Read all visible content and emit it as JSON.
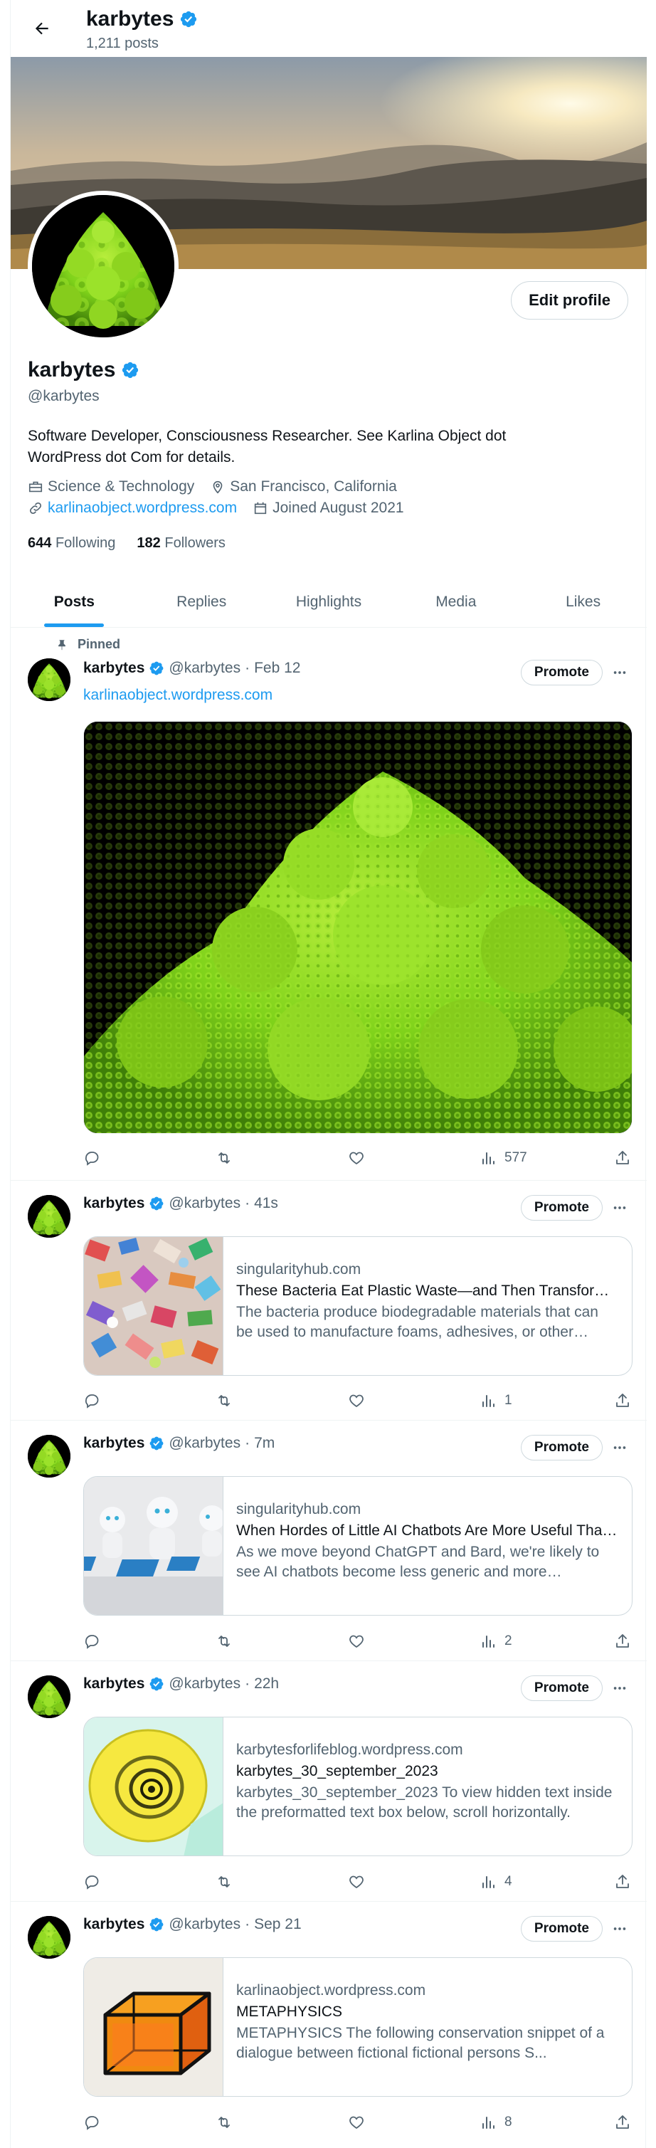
{
  "header": {
    "name": "karbytes",
    "post_count": "1,211 posts"
  },
  "profile": {
    "name": "karbytes",
    "handle": "@karbytes",
    "edit_label": "Edit profile",
    "bio": "Software Developer, Consciousness Researcher. See Karlina Object dot WordPress dot Com for details.",
    "category": "Science & Technology",
    "location": "San Francisco, California",
    "website": "karlinaobject.wordpress.com",
    "joined": "Joined August 2021",
    "following_count": "644",
    "following_label": "Following",
    "followers_count": "182",
    "followers_label": "Followers"
  },
  "tabs": [
    {
      "label": "Posts"
    },
    {
      "label": "Replies"
    },
    {
      "label": "Highlights"
    },
    {
      "label": "Media"
    },
    {
      "label": "Likes"
    }
  ],
  "posts": [
    {
      "pinned_label": "Pinned",
      "name": "karbytes",
      "handle": "@karbytes",
      "time": "Feb 12",
      "link": "karlinaobject.wordpress.com",
      "promote": "Promote",
      "views": "577"
    },
    {
      "name": "karbytes",
      "handle": "@karbytes",
      "time": "41s",
      "promote": "Promote",
      "card_domain": "singularityhub.com",
      "card_title": "These Bacteria Eat Plastic Waste—and Then Transform It Into Useful Products",
      "card_desc": "The bacteria produce biodegradable materials that can be used to manufacture foams, adhesives, or other products.",
      "views": "1"
    },
    {
      "name": "karbytes",
      "handle": "@karbytes",
      "time": "7m",
      "promote": "Promote",
      "card_domain": "singularityhub.com",
      "card_title": "When Hordes of Little AI Chatbots Are More Useful Than Giants",
      "card_desc": "As we move beyond ChatGPT and Bard, we're likely to see AI chatbots become less generic and more specialized.",
      "views": "2"
    },
    {
      "name": "karbytes",
      "handle": "@karbytes",
      "time": "22h",
      "promote": "Promote",
      "card_domain": "karbytesforlifeblog.wordpress.com",
      "card_title": "karbytes_30_september_2023",
      "card_desc": "karbytes_30_september_2023 To view hidden text inside the preformatted text box below, scroll horizontally.",
      "views": "4"
    },
    {
      "name": "karbytes",
      "handle": "@karbytes",
      "time": "Sep 21",
      "promote": "Promote",
      "card_domain": "karlinaobject.wordpress.com",
      "card_title": "METAPHYSICS",
      "card_desc": "METAPHYSICS The following conservation snippet of a dialogue between fictional fictional persons S...",
      "views": "8"
    }
  ],
  "colors": {
    "accent": "#1d9bf0",
    "secondary_text": "#536471",
    "border": "#eff3f4",
    "romanesco_green": "#7fd21a"
  },
  "icons": [
    "back-arrow-icon",
    "verified-badge-icon",
    "briefcase-icon",
    "location-pin-icon",
    "link-icon",
    "calendar-icon",
    "pin-icon",
    "more-icon",
    "reply-icon",
    "repost-icon",
    "like-icon",
    "views-icon",
    "share-icon"
  ]
}
